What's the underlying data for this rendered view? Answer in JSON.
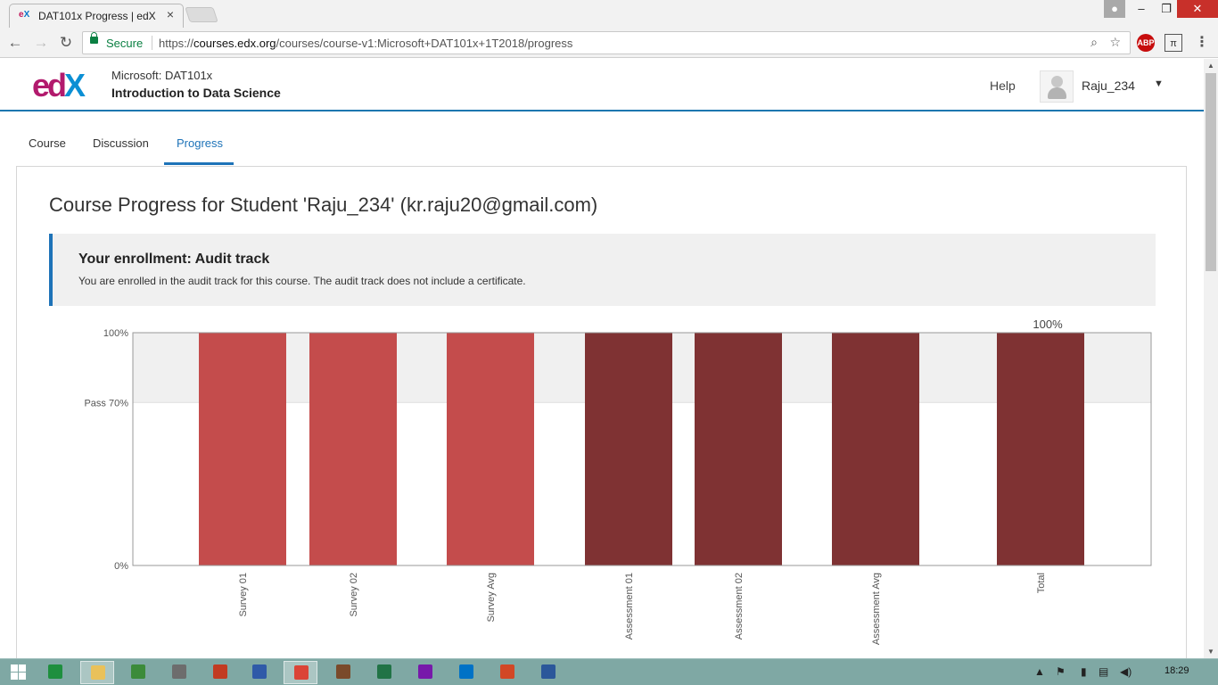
{
  "browser": {
    "tab_title": "DAT101x Progress | edX",
    "tab_favicon_e": "e",
    "tab_favicon_x": "X",
    "secure_label": "Secure",
    "url_scheme": "https://",
    "url_host": "courses.edx.org",
    "url_path": "/courses/course-v1:Microsoft+DAT101x+1T2018/progress",
    "abp_label": "ABP",
    "icons": [
      "back-arrow-icon",
      "forward-arrow-icon",
      "reload-icon",
      "lock-icon",
      "zoom-icon",
      "star-icon",
      "adblock-icon",
      "extension-icon",
      "menu-icon"
    ]
  },
  "site": {
    "logo_ed": "ed",
    "logo_x": "X",
    "course_org": "Microsoft: DAT101x",
    "course_name": "Introduction to Data Science",
    "help": "Help",
    "username": "Raju_234"
  },
  "tabs": [
    "Course",
    "Discussion",
    "Progress"
  ],
  "active_tab": "Progress",
  "progress": {
    "title": "Course Progress for Student 'Raju_234' (kr.raju20@gmail.com)",
    "enrollment_title": "Your enrollment: Audit track",
    "enrollment_message": "You are enrolled in the audit track for this course. The audit track does not include a certificate."
  },
  "chart_data": {
    "type": "bar",
    "categories": [
      "Survey 01",
      "Survey 02",
      "Survey Avg",
      "Assessment 01",
      "Assessment 02",
      "Assessment Avg",
      "Total"
    ],
    "values": [
      100,
      100,
      100,
      100,
      100,
      100,
      100
    ],
    "bar_colors": [
      "#c44c4c",
      "#c44c4c",
      "#c44c4c",
      "#7f3233",
      "#7f3233",
      "#7f3233",
      "#7f3233"
    ],
    "ylim": [
      0,
      100
    ],
    "yticks": [
      {
        "value": 100,
        "label": "100%"
      },
      {
        "value": 70,
        "label": "Pass 70%"
      },
      {
        "value": 0,
        "label": "0%"
      }
    ],
    "pass_threshold": 70,
    "total_label": "100%",
    "title": "",
    "xlabel": "",
    "ylabel": ""
  },
  "taskbar": {
    "clock": "18:29",
    "apps": [
      {
        "name": "excel-green-icon",
        "color": "#1e8f3e"
      },
      {
        "name": "file-explorer-icon",
        "color": "#e9c15a",
        "active": true
      },
      {
        "name": "downloader-icon",
        "color": "#3c8b3a"
      },
      {
        "name": "network-tool-icon",
        "color": "#6d6d6d"
      },
      {
        "name": "pdf-reader-icon",
        "color": "#c23b22"
      },
      {
        "name": "monitor-icon",
        "color": "#2f5aa8"
      },
      {
        "name": "chrome-icon",
        "color": "#db4437",
        "active": true
      },
      {
        "name": "media-app-icon",
        "color": "#7a4a2a"
      },
      {
        "name": "excel-icon",
        "color": "#217346"
      },
      {
        "name": "onenote-icon",
        "color": "#7719aa"
      },
      {
        "name": "outlook-icon",
        "color": "#0072c6"
      },
      {
        "name": "powerpoint-icon",
        "color": "#d24726"
      },
      {
        "name": "word-icon",
        "color": "#2b579a"
      }
    ],
    "tray_icons": [
      "tray-up-arrow-icon",
      "action-center-icon",
      "battery-icon",
      "network-icon",
      "volume-icon"
    ]
  }
}
